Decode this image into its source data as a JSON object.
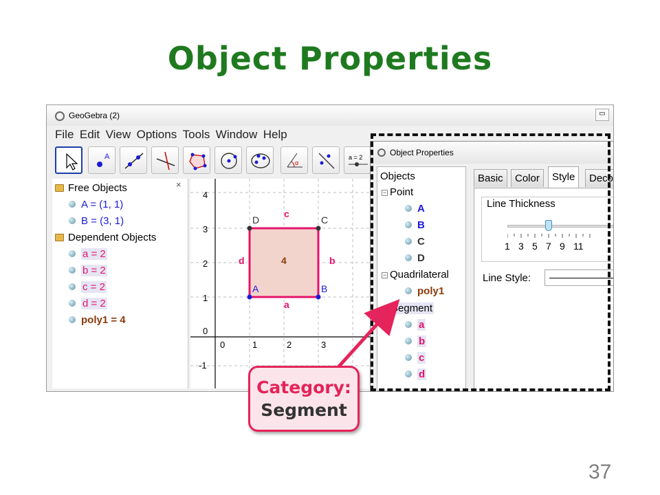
{
  "slide": {
    "title": "Object Properties",
    "page_number": "37"
  },
  "app": {
    "window_title": "GeoGebra (2)",
    "menu": [
      "File",
      "Edit",
      "View",
      "Options",
      "Tools",
      "Window",
      "Help"
    ],
    "close_symbol": "×",
    "minimize_symbol": "▭",
    "tool_label_slider": "a = 2"
  },
  "algebra": {
    "free_header": "Free Objects",
    "free_items": [
      "A = (1, 1)",
      "B = (3, 1)"
    ],
    "dependent_header": "Dependent Objects",
    "dependent_items": [
      "a = 2",
      "b = 2",
      "c = 2",
      "d = 2",
      "poly1 = 4"
    ]
  },
  "graphics": {
    "y_ticks": [
      "4",
      "3",
      "2",
      "1",
      "0",
      "-1"
    ],
    "x_ticks": [
      "0",
      "1",
      "2",
      "3"
    ],
    "point_labels": {
      "A": "A",
      "B": "B",
      "C": "C",
      "D": "D"
    },
    "segment_labels": {
      "a": "a",
      "b": "b",
      "c": "c",
      "d": "d"
    },
    "poly_label": "4"
  },
  "dialog": {
    "title": "Object Properties",
    "tree_header": "Objects",
    "tree": [
      {
        "label": "Point",
        "children": [
          "A",
          "B",
          "C",
          "D"
        ]
      },
      {
        "label": "Quadrilateral",
        "children": [
          "poly1"
        ]
      },
      {
        "label": "Segment",
        "children": [
          "a",
          "b",
          "c",
          "d"
        ]
      }
    ],
    "tabs": [
      "Basic",
      "Color",
      "Style",
      "Deco"
    ],
    "active_tab": "Style",
    "line_thickness_label": "Line Thickness",
    "slider_ticks": [
      "1",
      "3",
      "5",
      "7",
      "9",
      "11"
    ],
    "line_thickness_value": 5,
    "line_style_label": "Line Style:"
  },
  "callout": {
    "line1": "Category:",
    "line2": "Segment"
  },
  "colors": {
    "title": "#1f7a1f",
    "free_object": "#1a1ad6",
    "dependent_segment": "#e4146c",
    "polygon": "#8b3a0a",
    "accent_red": "#e4245a"
  }
}
